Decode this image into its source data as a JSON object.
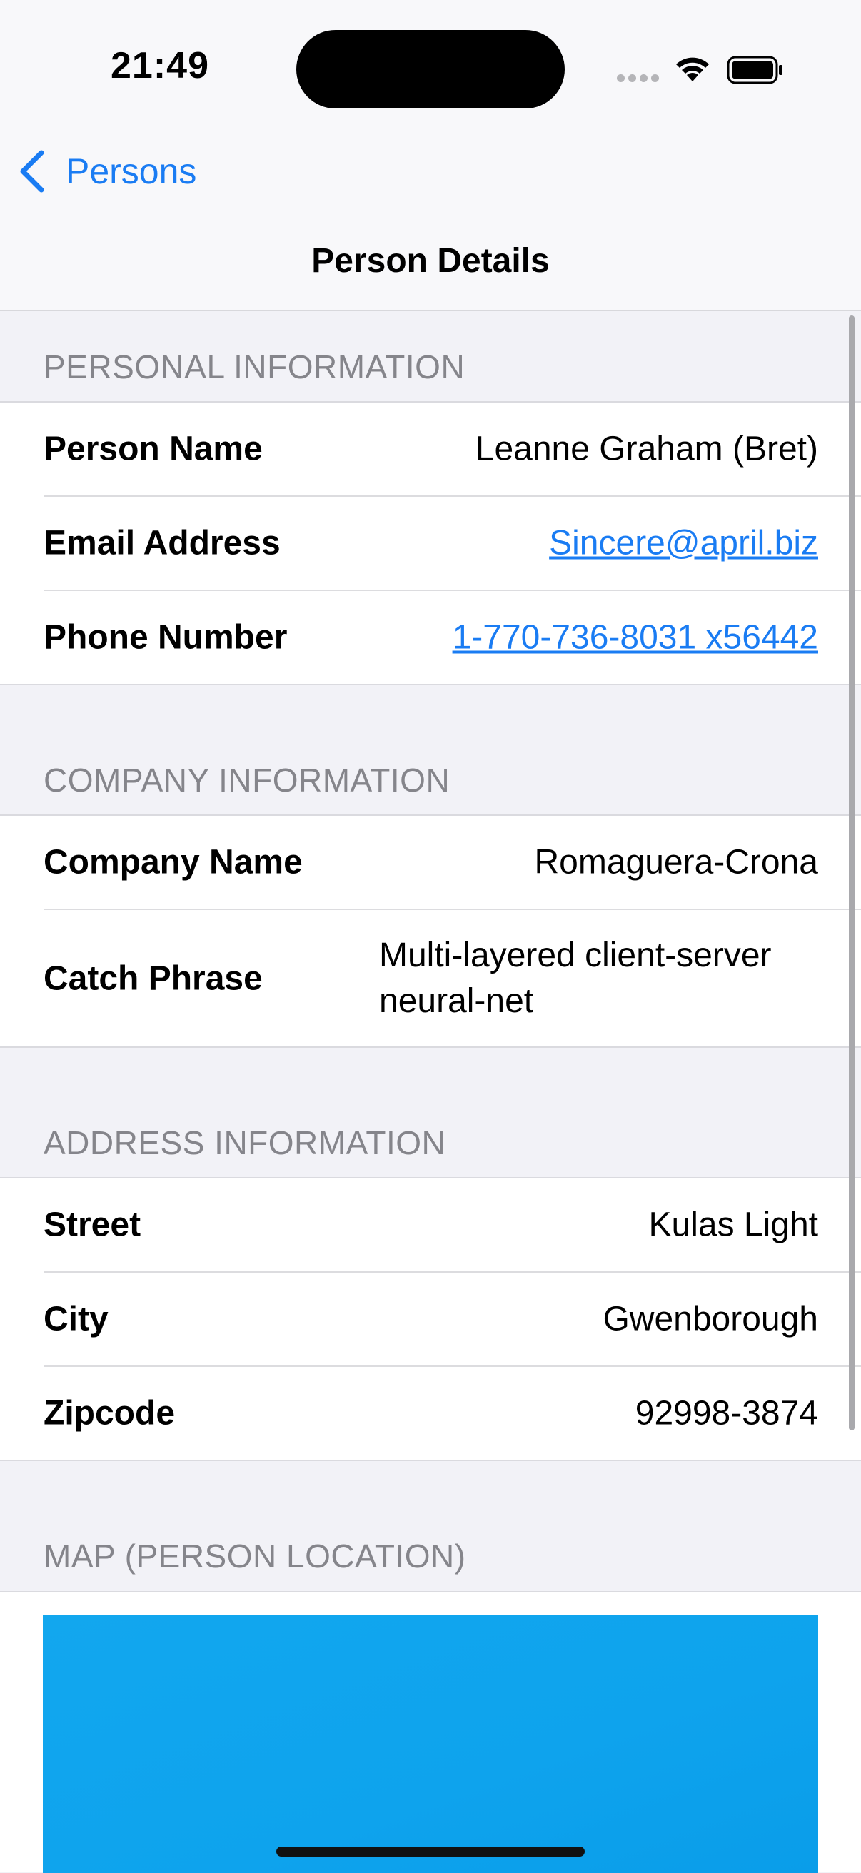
{
  "status_bar": {
    "time": "21:49",
    "icons": [
      "cellular-signal-icon",
      "wifi-icon",
      "battery-icon"
    ]
  },
  "nav": {
    "back_label": "Persons",
    "back_icon": "chevron-left-icon",
    "title": "Person Details"
  },
  "sections": {
    "personal": {
      "header": "PERSONAL INFORMATION",
      "rows": [
        {
          "label": "Person Name",
          "value": "Leanne Graham (Bret)"
        },
        {
          "label": "Email Address",
          "value": "Sincere@april.biz"
        },
        {
          "label": "Phone Number",
          "value": "1-770-736-8031 x56442"
        }
      ]
    },
    "company": {
      "header": "COMPANY INFORMATION",
      "rows": [
        {
          "label": "Company Name",
          "value": "Romaguera-Crona"
        },
        {
          "label": "Catch Phrase",
          "value": "Multi-layered client-server neural-net"
        }
      ]
    },
    "address": {
      "header": "ADDRESS INFORMATION",
      "rows": [
        {
          "label": "Street",
          "value": "Kulas Light"
        },
        {
          "label": "City",
          "value": "Gwenborough"
        },
        {
          "label": "Zipcode",
          "value": "92998-3874"
        }
      ]
    },
    "map": {
      "header": "MAP (PERSON LOCATION)"
    }
  },
  "colors": {
    "accent": "#1a7cf3",
    "background": "#f2f2f7",
    "section_header": "#85858b",
    "map_water": "#0ea3ed"
  }
}
